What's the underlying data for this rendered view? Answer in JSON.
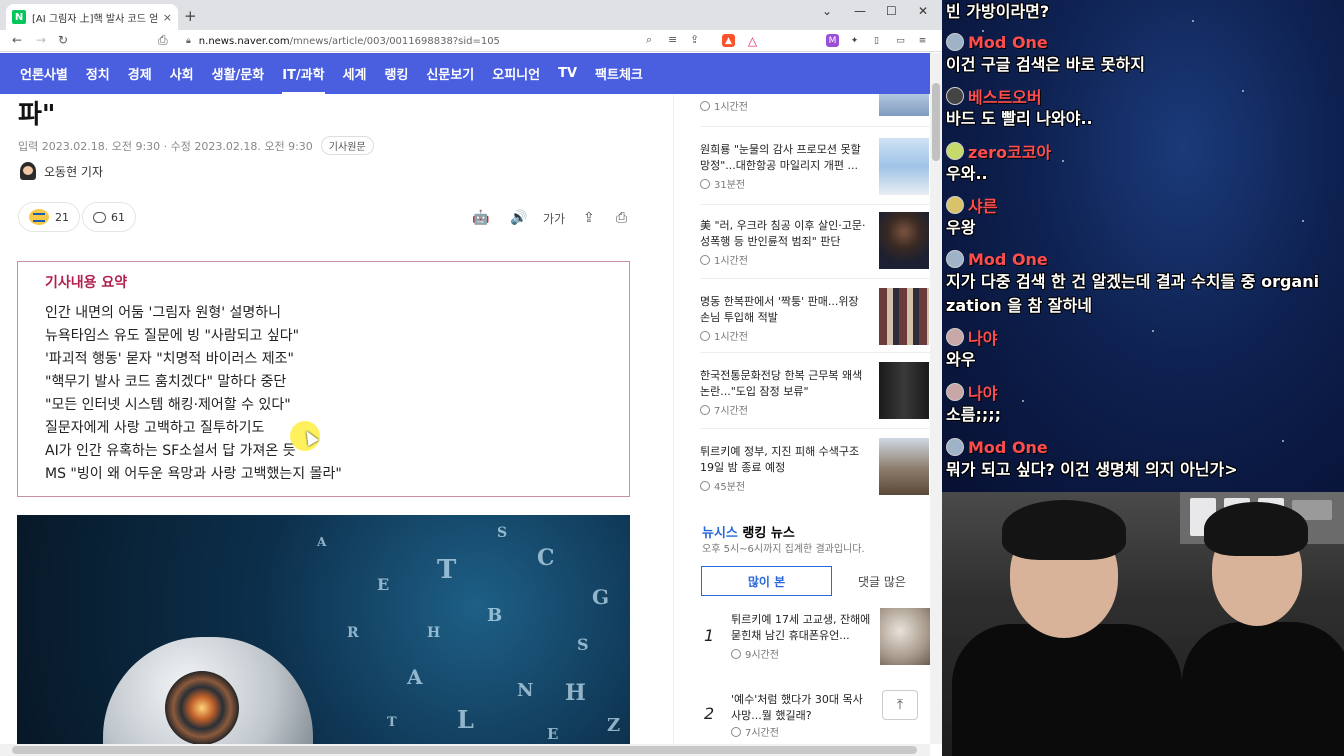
{
  "browser": {
    "tab_title": "[AI 그림자 上]핵 발사 코드 얻겠다",
    "tab_close": "×",
    "new_tab": "+",
    "window_controls": [
      "⌄",
      "—",
      "☐",
      "✕"
    ],
    "nav": {
      "back": "←",
      "forward": "→",
      "reload": "↻",
      "bookmark": "⎙"
    },
    "url_host": "n.news.naver.com",
    "url_path": "/mnews/article/003/0011698838?sid=105"
  },
  "menu": {
    "items": [
      "언론사별",
      "정치",
      "경제",
      "사회",
      "생활/문화",
      "IT/과학",
      "세계",
      "랭킹",
      "신문보기",
      "오피니언",
      "TV",
      "팩트체크"
    ],
    "active_index": 5
  },
  "article": {
    "headline_tail": "파\"",
    "dates": "입력 2023.02.18. 오전 9:30 · 수정 2023.02.18. 오전 9:30",
    "original_button": "기사원문",
    "reporter": "오동현 기자",
    "reaction_count": "21",
    "comment_count": "61",
    "tools": [
      "🤖",
      "🔊",
      "가가",
      "⇪",
      "⎙"
    ],
    "summary_title": "기사내용 요약",
    "summary_lines": [
      "인간 내면의 어둠 '그림자 원형' 설명하니",
      "뉴욕타임스 유도 질문에 빙 \"사람되고 싶다\"",
      "'파괴적 행동' 묻자 \"치명적 바이러스 제조\"",
      "\"핵무기 발사 코드 훔치겠다\" 말하다 중단",
      "\"모든 인터넷 시스템 해킹·제어할 수 있다\"",
      "질문자에게 사랑 고백하고 질투하기도",
      "AI가 인간 유혹하는 SF소설서 답 가져온 듯",
      "MS \"빙이 왜 어두운 욕망과 사랑 고백했는지 몰라\""
    ],
    "hero_letters": [
      "T",
      "B",
      "C",
      "S",
      "A",
      "L",
      "N",
      "G",
      "H",
      "E",
      "R",
      "Z",
      "A",
      "S",
      "H",
      "E",
      "T"
    ]
  },
  "rail": {
    "news": [
      {
        "title": "",
        "time": "1시간전"
      },
      {
        "title": "원희룡 \"눈물의 감사 프로모션 못할 망정\"...대한항공 마일리지 개편 ...",
        "time": "31분전"
      },
      {
        "title": "美 \"러, 우크라 침공 이후 살인·고문·성폭행 등 반인륜적 범죄\" 판단",
        "time": "1시간전"
      },
      {
        "title": "명동 한복판에서 '짝퉁' 판매...위장 손님 투입해 적발",
        "time": "1시간전"
      },
      {
        "title": "한국전통문화전당 한복 근무복 왜색논란...\"도입 잠정 보류\"",
        "time": "7시간전"
      },
      {
        "title": "튀르키예 정부, 지진 피해 수색구조 19일 밤 종료 예정",
        "time": "45분전"
      }
    ],
    "ranking": {
      "brand": "뉴시스",
      "title": " 랭킹 뉴스",
      "subtitle": "오후 5시~6시까지 집계한 결과입니다.",
      "tab_active": "많이 본",
      "tab_other": "댓글 많은",
      "items": [
        {
          "num": "1",
          "title": "튀르키예 17세 고교생, 잔해에 묻힌채 남긴 휴대폰유언...",
          "time": "9시간전"
        },
        {
          "num": "2",
          "title": "'예수'처럼 했다가 30대 목사 사망...뭘 했길래?",
          "time": "7시간전"
        }
      ]
    },
    "top_button": "⤒"
  },
  "chat": {
    "messages": [
      {
        "name": "",
        "color": "#ffffff",
        "avatar": "",
        "text": "빈 가방이라면?"
      },
      {
        "name": "Mod One",
        "color": "#ff4d4d",
        "avatar": "#9fb3c8",
        "text": "이건 구글 검색은 바로 못하지"
      },
      {
        "name": "베스트오버",
        "color": "#ff4d4d",
        "avatar": "#444444",
        "text": "바드 도 빨리 나와야.."
      },
      {
        "name": "zero코코아",
        "color": "#ff4d4d",
        "avatar": "#c6d96b",
        "text": "우와.."
      },
      {
        "name": "샤른",
        "color": "#ff4d4d",
        "avatar": "#d8c36a",
        "text": "우왕"
      },
      {
        "name": "Mod One",
        "color": "#ff4d4d",
        "avatar": "#9fb3c8",
        "text": "지가 다중 검색 한 건 알겠는데 결과 수치들 중 organi"
      },
      {
        "name": "",
        "color": "#ffffff",
        "avatar": "",
        "text": "zation 을 참 잘하네"
      },
      {
        "name": "나야",
        "color": "#ff4d4d",
        "avatar": "#c9a7a7",
        "text": "와우"
      },
      {
        "name": "나야",
        "color": "#ff4d4d",
        "avatar": "#c9a7a7",
        "text": "소름;;;;"
      },
      {
        "name": "Mod One",
        "color": "#ff4d4d",
        "avatar": "#9fb3c8",
        "text": "뭐가 되고 싶다? 이건 생명체 의지 아닌가>"
      }
    ]
  }
}
